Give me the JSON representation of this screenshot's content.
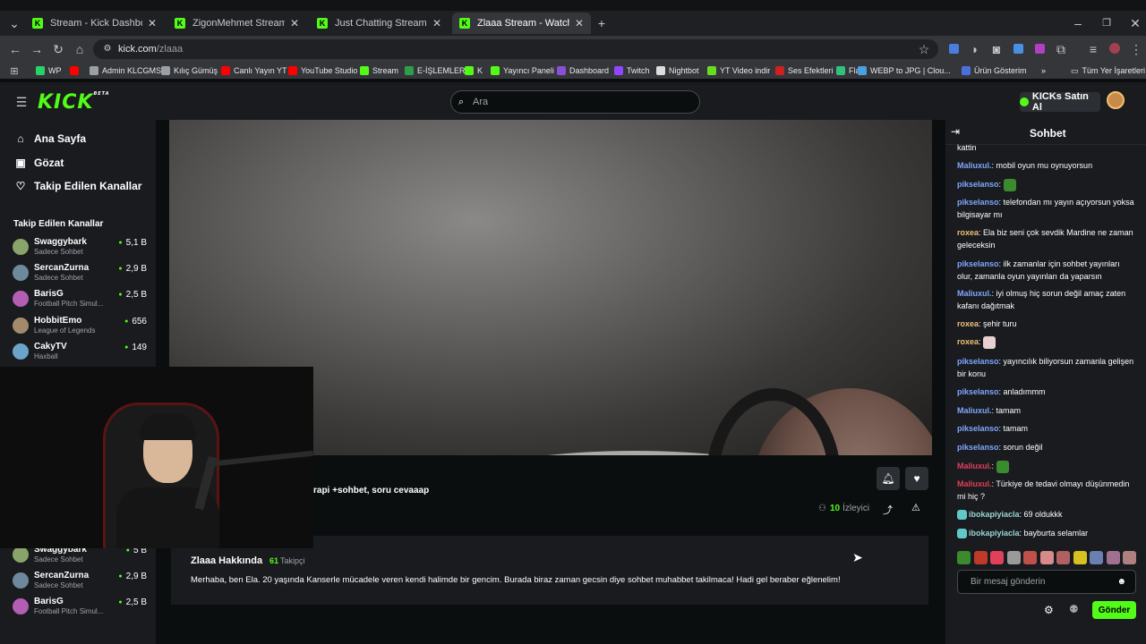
{
  "browser": {
    "tabs": [
      {
        "title": "Stream - Kick Dashboard",
        "active": false
      },
      {
        "title": "ZigonMehmet Stream - Watch",
        "active": false
      },
      {
        "title": "Just Chatting Streaming - Live S",
        "active": false
      },
      {
        "title": "Zlaaa Stream - Watch Live on K",
        "active": true
      }
    ],
    "url_host": "kick.com",
    "url_path": "/zlaaa",
    "bookmarks": [
      "WP",
      "",
      "Admin KLCGMS",
      "Kılıç Gümüş",
      "Canlı Yayın YT",
      "YouTube Studio",
      "Stream",
      "E-İŞLEMLER",
      "K",
      "Yayıncı Paneli",
      "Dashboard",
      "Twitch",
      "Nightbot",
      "YT Video indir",
      "Ses Efektleri",
      "Flat",
      "WEBP to JPG | Clou...",
      "Ürün Gösterim"
    ],
    "bookmarks_overflow": "»",
    "all_bookmarks": "Tüm Yer İşaretleri"
  },
  "header": {
    "logo": "KICK",
    "logo_badge": "BETA",
    "search_placeholder": "Ara",
    "buy_kicks": "KICKs Satın Al"
  },
  "sidebar": {
    "nav": [
      {
        "label": "Ana Sayfa",
        "icon": "home-icon"
      },
      {
        "label": "Gözat",
        "icon": "browse-icon"
      },
      {
        "label": "Takip Edilen Kanallar",
        "icon": "heart-icon"
      }
    ],
    "followed_heading": "Takip Edilen Kanallar",
    "channels": [
      {
        "name": "Swaggybark",
        "category": "Sadece Sohbet",
        "viewers": "5,1 B",
        "color": "#8aa36b"
      },
      {
        "name": "SercanZurna",
        "category": "Sadece Sohbet",
        "viewers": "2,9 B",
        "color": "#6d8a9c"
      },
      {
        "name": "BarisG",
        "category": "Football Pitch Simul...",
        "viewers": "2,5 B",
        "color": "#b35db3"
      },
      {
        "name": "HobbitEmo",
        "category": "League of Legends",
        "viewers": "656",
        "color": "#a38a6b"
      },
      {
        "name": "CakyTV",
        "category": "Haxball",
        "viewers": "149",
        "color": "#6ba3c9"
      }
    ],
    "channels_repeat": [
      {
        "name": "Swaggybark",
        "category": "Sadece Sohbet",
        "viewers": "5 B",
        "color": "#8aa36b"
      },
      {
        "name": "SercanZurna",
        "category": "Sadece Sohbet",
        "viewers": "2,9 B",
        "color": "#6d8a9c"
      },
      {
        "name": "BarisG",
        "category": "Football Pitch Simul...",
        "viewers": "2,5 B",
        "color": "#b35db3"
      }
    ]
  },
  "stream": {
    "title_fragment": "rapi +sohbet, soru cevaaap",
    "viewers_count": "10",
    "viewers_label": "İzleyici"
  },
  "about": {
    "name": "Zlaaa Hakkında",
    "followers_count": "61",
    "followers_label": "Takipçi",
    "bio": "Merhaba, ben Ela. 20 yaşında Kanserle mücadele veren kendi halimde bir gencim. Burada biraz zaman gecsin diye sohbet muhabbet takilmaca! Hadi gel beraber eğlenelim!"
  },
  "chat": {
    "title": "Sohbet",
    "input_placeholder": "Bir mesaj gönderin",
    "send_label": "Gönder",
    "messages": [
      {
        "user": "",
        "text": "kattin",
        "color": "#ffffff"
      },
      {
        "user": "Maliuxul.",
        "text": ": mobil oyun mu oynuyorsun",
        "color": "#7fa7ff"
      },
      {
        "user": "pikselanso",
        "text": ": ",
        "color": "#7fa7ff",
        "emote": "#3c8a2e"
      },
      {
        "user": "pikselanso",
        "text": ": telefondan mı yayın açıyorsun yoksa bilgisayar mı",
        "color": "#7fa7ff"
      },
      {
        "user": "roxea",
        "text": ": Ela biz seni çok sevdik Mardine ne zaman geleceksin",
        "color": "#f2c078"
      },
      {
        "user": "pikselanso",
        "text": ": ilk zamanlar için sohbet yayınları olur, zamanla oyun yayınları da yaparsın",
        "color": "#7fa7ff"
      },
      {
        "user": "Maliuxul.",
        "text": ": iyi olmuş hiç sorun değil amaç zaten kafanı dağıtmak",
        "color": "#7fa7ff"
      },
      {
        "user": "roxea",
        "text": ": şehir turu",
        "color": "#f2c078"
      },
      {
        "user": "roxea",
        "text": ": ",
        "color": "#f2c078",
        "emote": "#e8d0d0"
      },
      {
        "user": "pikselanso",
        "text": ": yayıncılık biliyorsun zamanla gelişen bir konu",
        "color": "#7fa7ff"
      },
      {
        "user": "pikselanso",
        "text": ": anladımmm",
        "color": "#7fa7ff"
      },
      {
        "user": "Maliuxul.",
        "text": ": tamam",
        "color": "#7fa7ff"
      },
      {
        "user": "pikselanso",
        "text": ": tamam",
        "color": "#7fa7ff"
      },
      {
        "user": "pikselanso",
        "text": ": sorun değil",
        "color": "#7fa7ff"
      },
      {
        "user": "Maliuxul.",
        "text": ": ",
        "color": "#e0405a",
        "emote": "#3c8a2e"
      },
      {
        "user": "Maliuxul.",
        "text": ": Türkiye de tedavi olmayı düşünmedin mi hiç ?",
        "color": "#e0405a"
      },
      {
        "user": "ibokapiyiacla",
        "text": ": 69 oldukkk",
        "color": "#9ad4d4",
        "badge": true
      },
      {
        "user": "ibokapiyiacla",
        "text": ": bayburta selamlar",
        "color": "#9ad4d4",
        "badge": true
      }
    ],
    "emote_colors": [
      "#3c8a2e",
      "#c0392b",
      "#e0405a",
      "#9a9a9a",
      "#c0504a",
      "#d88a8a",
      "#b06060",
      "#d8c020",
      "#6a80b0",
      "#a07090",
      "#b08080"
    ]
  },
  "colors": {
    "accent": "#53fc18",
    "panel": "#191b1f",
    "background": "#0b0e0f"
  }
}
